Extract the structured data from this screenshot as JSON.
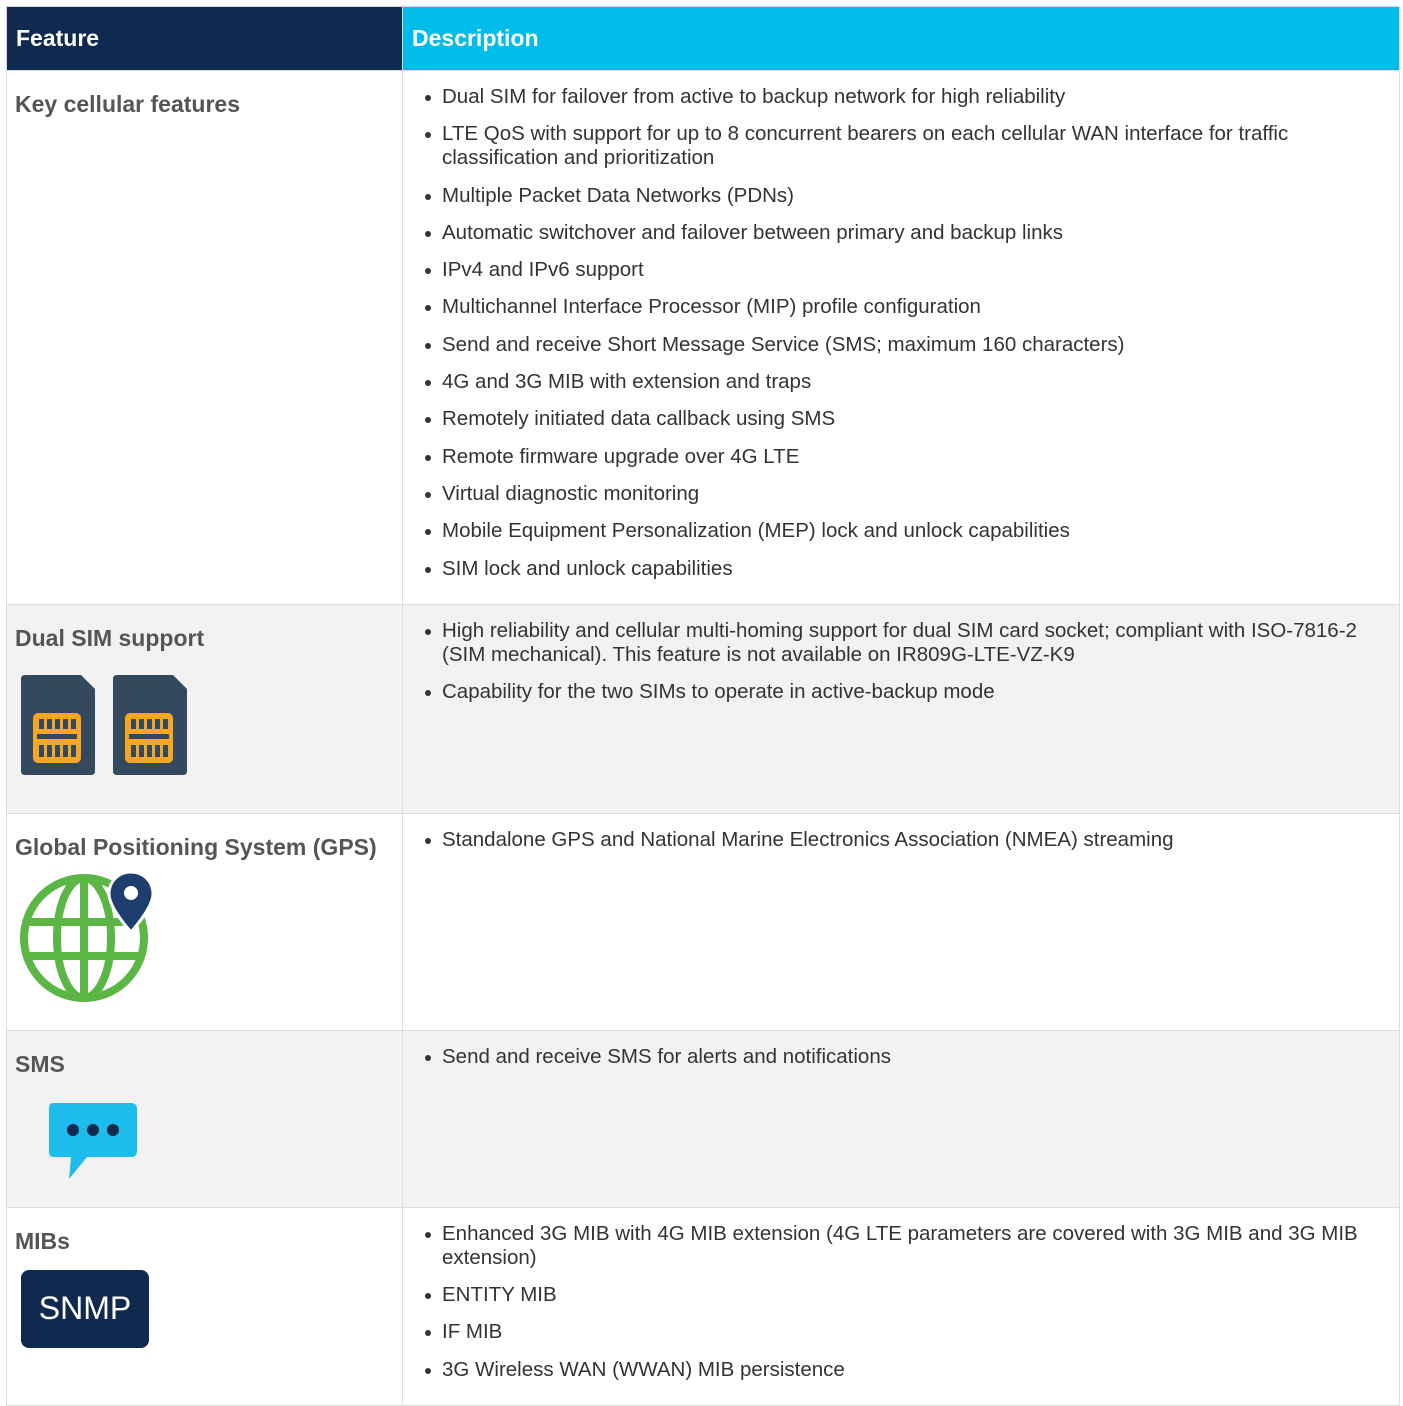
{
  "header": {
    "feature": "Feature",
    "description": "Description"
  },
  "rows": [
    {
      "feature": "Key cellular features",
      "icon": "none",
      "bullets": [
        "Dual SIM for failover from active to backup network for high reliability",
        "LTE QoS with support for up to 8 concurrent bearers on each cellular WAN interface for traffic classification and prioritization",
        "Multiple Packet Data Networks (PDNs)",
        "Automatic switchover and failover between primary and backup links",
        "IPv4 and IPv6 support",
        "Multichannel Interface Processor (MIP) profile configuration",
        "Send and receive Short Message Service (SMS; maximum 160 characters)",
        "4G and 3G MIB with extension and traps",
        "Remotely initiated data callback using SMS",
        "Remote firmware upgrade over 4G LTE",
        "Virtual diagnostic monitoring",
        "Mobile Equipment Personalization (MEP) lock and unlock capabilities",
        "SIM lock and unlock capabilities"
      ]
    },
    {
      "feature": "Dual SIM support",
      "icon": "sim-card-icon",
      "bullets": [
        "High reliability and cellular multi-homing support for dual SIM card socket; compliant with ISO-7816-2 (SIM mechanical). This feature is not available on IR809G-LTE-VZ-K9",
        "Capability for the two SIMs to operate in active-backup mode"
      ]
    },
    {
      "feature": "Global Positioning System (GPS)",
      "icon": "globe-location-icon",
      "bullets": [
        "Standalone GPS and National Marine Electronics Association (NMEA) streaming"
      ]
    },
    {
      "feature": "SMS",
      "icon": "chat-bubble-icon",
      "bullets": [
        "Send and receive SMS for alerts and notifications"
      ]
    },
    {
      "feature": "MIBs",
      "icon": "snmp-badge-icon",
      "icon_text": "SNMP",
      "bullets": [
        "Enhanced 3G MIB with 4G MIB extension (4G LTE parameters are covered with 3G MIB and 3G MIB extension)",
        "ENTITY MIB",
        "IF MIB",
        "3G Wireless WAN (WWAN) MIB persistence"
      ]
    }
  ],
  "colors": {
    "feature_header_bg": "#0f2a4e",
    "description_header_bg": "#00bceb",
    "sim_body": "#34495e",
    "sim_chip": "#f5a623",
    "globe": "#5cb646",
    "pin": "#1d3e6e",
    "chat_bubble": "#1ebcec"
  }
}
